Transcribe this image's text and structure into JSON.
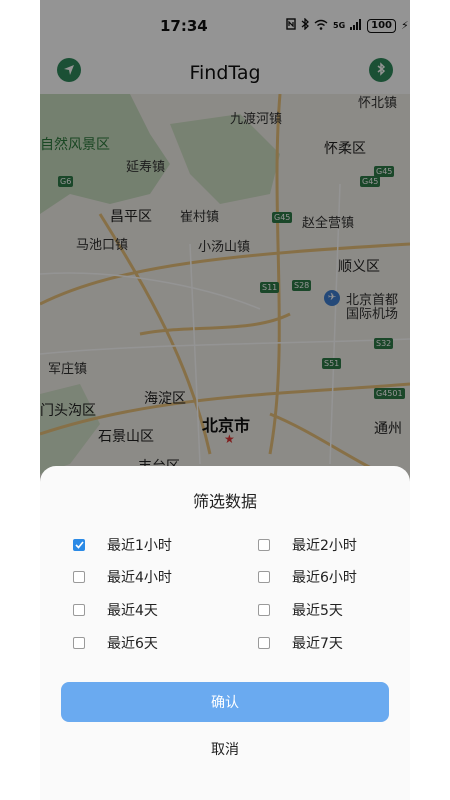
{
  "status_bar": {
    "time": "17:34",
    "icons": [
      "nfc-icon",
      "bluetooth-icon",
      "wifi-icon",
      "signal-icon"
    ],
    "signal_label": "5G",
    "battery": "100"
  },
  "app_bar": {
    "title": "FindTag",
    "left_button_icon": "location-arrow-icon",
    "right_button_icon": "bluetooth-icon",
    "accent_color": "#2f8a5c"
  },
  "map": {
    "labels": [
      "怀北镇",
      "九渡河镇",
      "自然风景区",
      "延寿镇",
      "怀柔区",
      "昌平区",
      "崔村镇",
      "赵全营镇",
      "马池口镇",
      "小汤山镇",
      "顺义区",
      "北京首都",
      "国际机场",
      "军庄镇",
      "海淀区",
      "门头沟区",
      "北京市",
      "通州",
      "石景山区",
      "丰台区"
    ],
    "road_shields": [
      "G6",
      "G45",
      "G45",
      "S11",
      "S28",
      "S32",
      "S51",
      "G4501",
      "G45"
    ]
  },
  "filter_sheet": {
    "title": "筛选数据",
    "options": [
      {
        "label": "最近1小时",
        "checked": true
      },
      {
        "label": "最近2小时",
        "checked": false
      },
      {
        "label": "最近4小时",
        "checked": false
      },
      {
        "label": "最近6小时",
        "checked": false
      },
      {
        "label": "最近4天",
        "checked": false
      },
      {
        "label": "最近5天",
        "checked": false
      },
      {
        "label": "最近6天",
        "checked": false
      },
      {
        "label": "最近7天",
        "checked": false
      }
    ],
    "confirm_label": "确认",
    "cancel_label": "取消",
    "confirm_color": "#6aaaf0"
  }
}
